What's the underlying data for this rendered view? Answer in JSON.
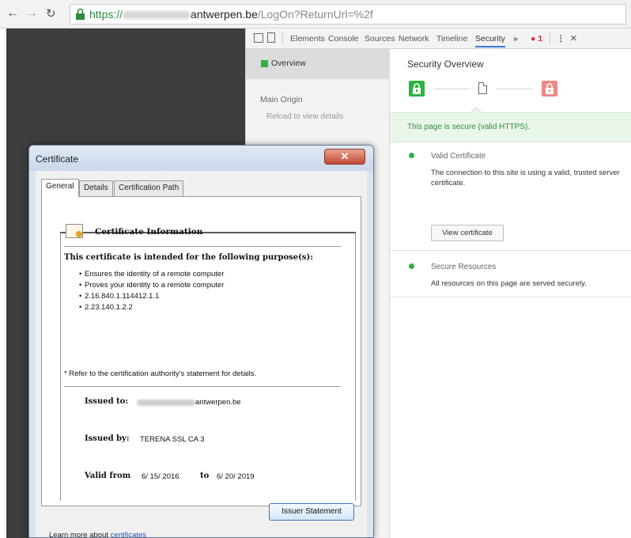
{
  "browser": {
    "url": {
      "scheme": "https://",
      "host_suffix": "antwerpen.be",
      "path": "/LogOn?ReturnUrl=%2f"
    }
  },
  "devtools": {
    "tabs": [
      "Elements",
      "Console",
      "Sources",
      "Network",
      "Timeline",
      "Security"
    ],
    "active_tab": "Security",
    "overflow": "»",
    "error_count": "1",
    "menu": "⋮",
    "close": "×",
    "sidebar": {
      "overview": "Overview",
      "main_origin": "Main Origin",
      "reload_hint": "Reload to view details"
    },
    "main": {
      "title": "Security Overview",
      "secure_banner": "This page is secure (valid HTTPS).",
      "items": [
        {
          "title": "Valid Certificate",
          "text": "The connection to this site is using a valid, trusted server certificate.",
          "button": "View certificate"
        },
        {
          "title": "Secure Resources",
          "text": "All resources on this page are served securely."
        }
      ]
    }
  },
  "certificate_dialog": {
    "title": "Certificate",
    "close": "✕",
    "tabs": [
      "General",
      "Details",
      "Certification Path"
    ],
    "info_title": "Certificate Information",
    "purpose_heading": "This certificate is intended for the following purpose(s):",
    "purposes": [
      "Ensures the identity of a remote computer",
      "Proves your identity to a remote computer",
      "2.16.840.1.114412.1.1",
      "2.23.140.1.2.2"
    ],
    "refer_note": "* Refer to the certification authority's statement for details.",
    "issued_to_label": "Issued to:",
    "issued_to_value": "antwerpen.be",
    "issued_by_label": "Issued by:",
    "issued_by_value": "TERENA SSL CA 3",
    "valid_from_label": "Valid from",
    "valid_from_value": "6/ 15/ 2016",
    "valid_to_label": "to",
    "valid_to_value": "6/ 20/ 2019",
    "issuer_statement_button": "Issuer Statement",
    "learn_more_prefix": "Learn more about ",
    "learn_more_link": "certificates"
  }
}
